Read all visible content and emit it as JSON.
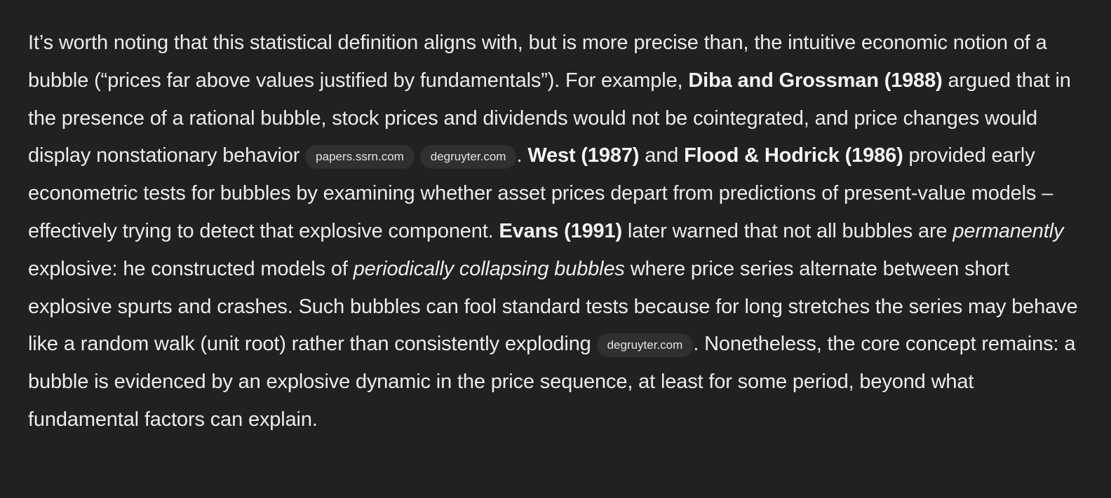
{
  "paragraph": {
    "t1": "It’s worth noting that this statistical definition aligns with, but is more precise than, the intuitive economic notion of a bubble (“prices far above values justified by fundamentals”). For example, ",
    "b1": "Diba and Grossman (1988)",
    "t2": " argued that in the presence of a rational bubble, stock prices and dividends would not be cointegrated, and price changes would display nonstationary behavior ",
    "c1": "papers.ssrn.com",
    "c2": "degruyter.com",
    "t3": ". ",
    "b2": "West (1987)",
    "t4": " and ",
    "b3": "Flood & Hodrick (1986)",
    "t5": " provided early econometric tests for bubbles by examining whether asset prices depart from predictions of present-value models – effectively trying to detect that explosive component. ",
    "b4": "Evans (1991)",
    "t6": " later warned that not all bubbles are ",
    "i1": "permanently",
    "t7": " explosive: he constructed models of ",
    "i2": "periodically collapsing bubbles",
    "t8": " where price series alternate between short explosive spurts and crashes. Such bubbles can fool standard tests because for long stretches the series may behave like a random walk (unit root) rather than consistently exploding ",
    "c3": "degruyter.com",
    "t9": ". Nonetheless, the core concept remains: a bubble is evidenced by an explosive dynamic in the price sequence, at least for some period, beyond what fundamental factors can explain."
  }
}
